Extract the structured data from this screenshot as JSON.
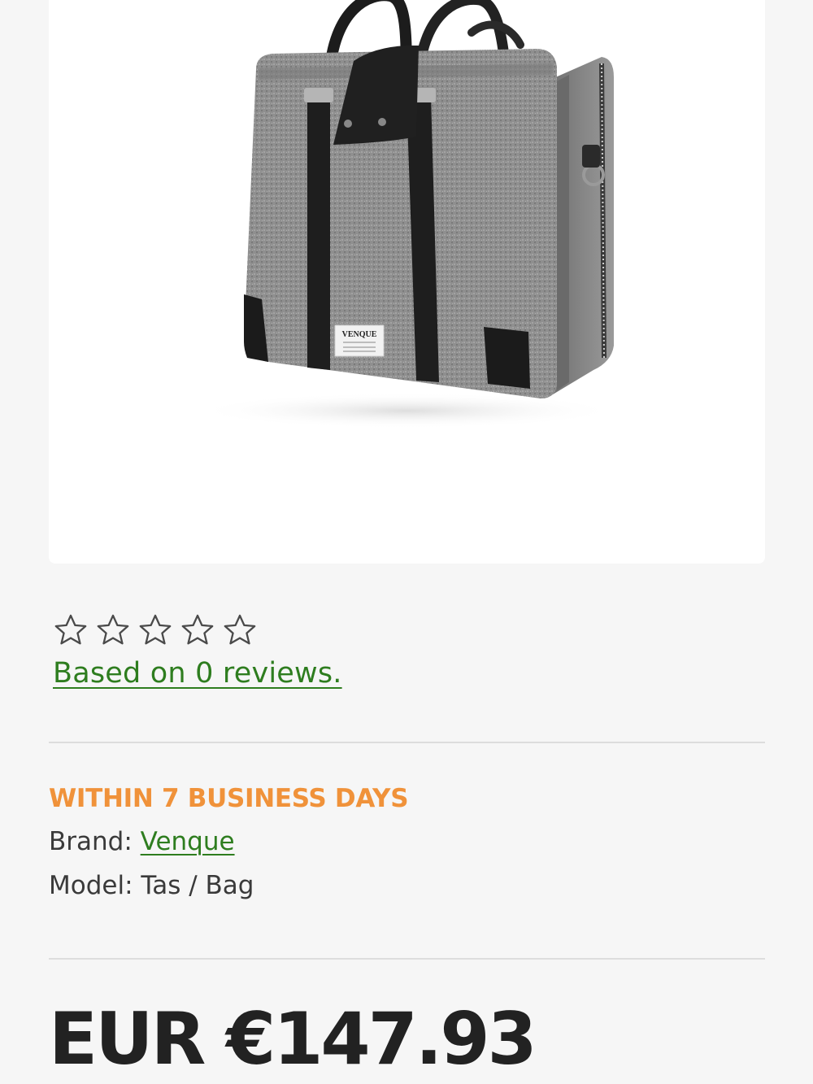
{
  "product": {
    "image_icon": "product-image-bag",
    "label_patch": {
      "line1": "VENQUE"
    },
    "rating": {
      "stars_filled": 0,
      "stars_total": 5,
      "icon": "star-outline-icon",
      "reviews_text": "Based on 0 reviews."
    },
    "delivery": "WITHIN 7 BUSINESS DAYS",
    "brand": {
      "label": "Brand:",
      "value": "Venque"
    },
    "model": {
      "label": "Model:",
      "value": "Tas / Bag"
    },
    "price": "EUR €147.93"
  },
  "colors": {
    "accent_green": "#2e7d1f",
    "delivery_orange": "#f0923a",
    "background": "#f6f6f6"
  }
}
